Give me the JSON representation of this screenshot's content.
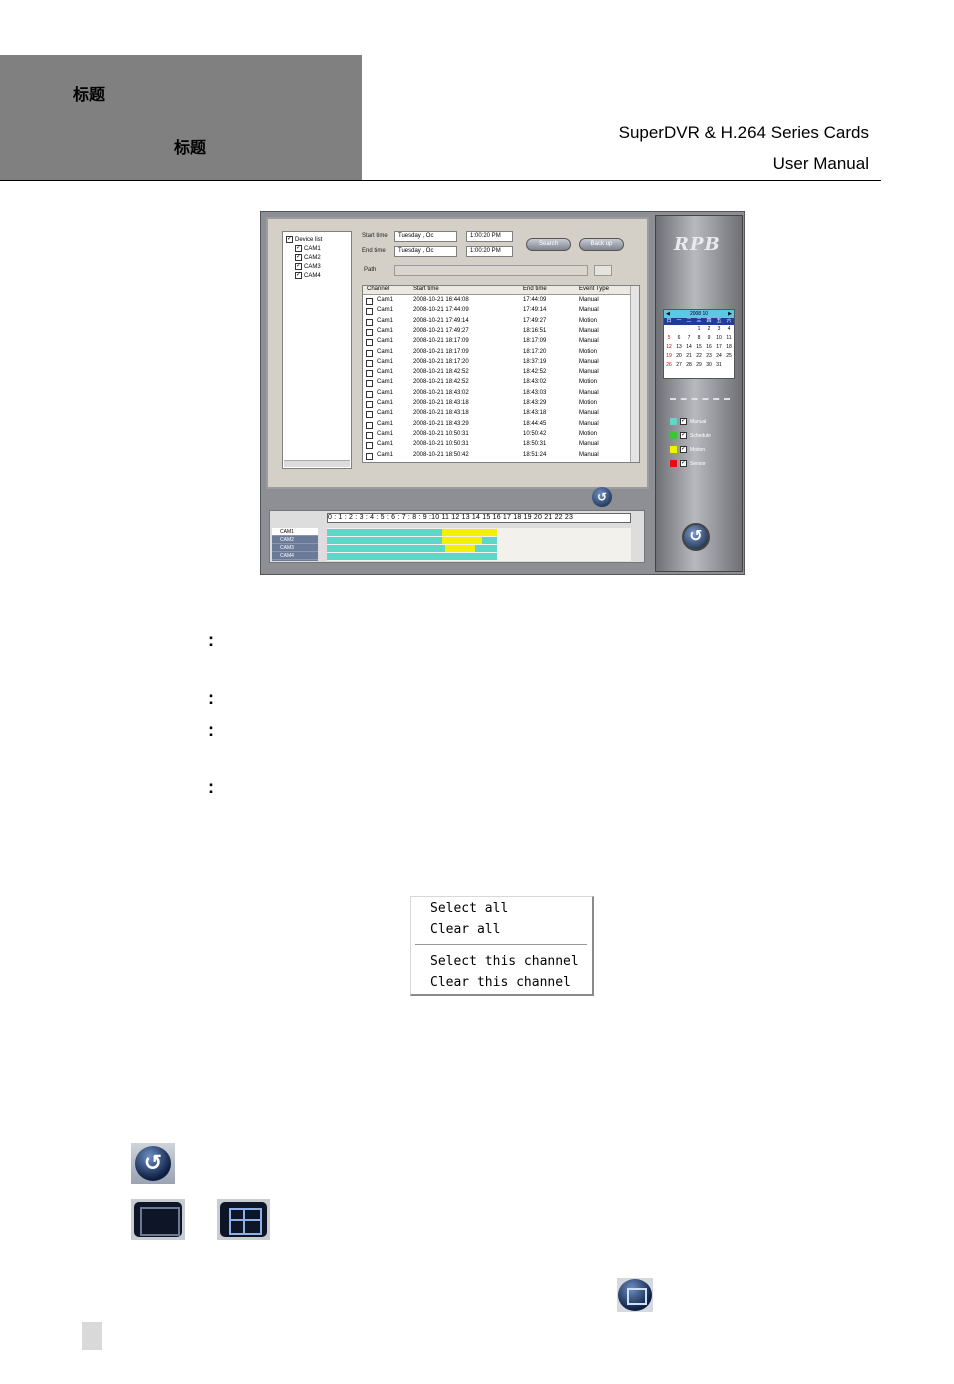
{
  "header": {
    "left_title_1": "标题",
    "left_title_2": "标题",
    "right_line_1": "SuperDVR & H.264 Series Cards",
    "right_line_2": "User  Manual"
  },
  "screenshot": {
    "device_list": {
      "root": "Device list",
      "items": [
        "CAM1",
        "CAM2",
        "CAM3",
        "CAM4"
      ]
    },
    "search": {
      "start_label": "Start time",
      "end_label": "End time",
      "start_date": "Tuesday  ,  Oc",
      "end_date": "Tuesday  ,  Oc",
      "start_time": "1:00:20 PM",
      "end_time": "1:00:20 PM",
      "search_button": "Search",
      "backup_button": "Back up",
      "path_label": "Path"
    },
    "table": {
      "columns": [
        "Channel",
        "Start time",
        "End time",
        "Event Type"
      ],
      "rows": [
        [
          "Cam1",
          "2008-10-21 16:44:08",
          "17:44:09",
          "Manual"
        ],
        [
          "Cam1",
          "2008-10-21 17:44:09",
          "17:49:14",
          "Manual"
        ],
        [
          "Cam1",
          "2008-10-21 17:49:14",
          "17:49:27",
          "Motion"
        ],
        [
          "Cam1",
          "2008-10-21 17:49:27",
          "18:16:51",
          "Manual"
        ],
        [
          "Cam1",
          "2008-10-21 18:17:09",
          "18:17:09",
          "Manual"
        ],
        [
          "Cam1",
          "2008-10-21 18:17:09",
          "18:17:20",
          "Motion"
        ],
        [
          "Cam1",
          "2008-10-21 18:17:20",
          "18:37:19",
          "Manual"
        ],
        [
          "Cam1",
          "2008-10-21 18:42:52",
          "18:42:52",
          "Manual"
        ],
        [
          "Cam1",
          "2008-10-21 18:42:52",
          "18:43:02",
          "Motion"
        ],
        [
          "Cam1",
          "2008-10-21 18:43:02",
          "18:43:03",
          "Manual"
        ],
        [
          "Cam1",
          "2008-10-21 18:43:18",
          "18:43:29",
          "Motion"
        ],
        [
          "Cam1",
          "2008-10-21 18:43:18",
          "18:43:18",
          "Manual"
        ],
        [
          "Cam1",
          "2008-10-21 18:43:29",
          "18:44:45",
          "Manual"
        ],
        [
          "Cam1",
          "2008-10-21 10:50:31",
          "10:50:42",
          "Motion"
        ],
        [
          "Cam1",
          "2008-10-21 10:50:31",
          "18:50:31",
          "Manual"
        ],
        [
          "Cam1",
          "2008-10-21 18:50:42",
          "18:51:24",
          "Manual"
        ]
      ]
    },
    "timeline": {
      "hours": "0 : 1 : 2 : 3 : 4 : 5 : 6 : 7 : 8 : 9 :10 11 12 13 14 15 16 17 18 19 20 21 22 23",
      "channels": [
        "CAM1",
        "CAM2",
        "CAM3",
        "CAM4"
      ]
    },
    "sidebar": {
      "logo": "RPB",
      "calendar_title": "2008 10",
      "weekdays": [
        "日",
        "一",
        "二",
        "三",
        "四",
        "五",
        "六"
      ],
      "days": [
        "",
        "",
        "",
        "1",
        "2",
        "3",
        "4",
        "5",
        "6",
        "7",
        "8",
        "9",
        "10",
        "11",
        "12",
        "13",
        "14",
        "15",
        "16",
        "17",
        "18",
        "19",
        "20",
        "21",
        "22",
        "23",
        "24",
        "25",
        "26",
        "27",
        "28",
        "29",
        "30",
        "31",
        ""
      ],
      "legend": [
        {
          "label": "Manual",
          "color": "#5fd6c8"
        },
        {
          "label": "Schedule",
          "color": "#37c837"
        },
        {
          "label": "Motion",
          "color": "#f2f200"
        },
        {
          "label": "Sensor",
          "color": "#e01010"
        }
      ]
    }
  },
  "colons": [
    ":",
    ":",
    ":",
    ":"
  ],
  "context_menu": {
    "items": [
      "Select all",
      "Clear all",
      "Select this channel",
      "Clear this channel"
    ]
  }
}
